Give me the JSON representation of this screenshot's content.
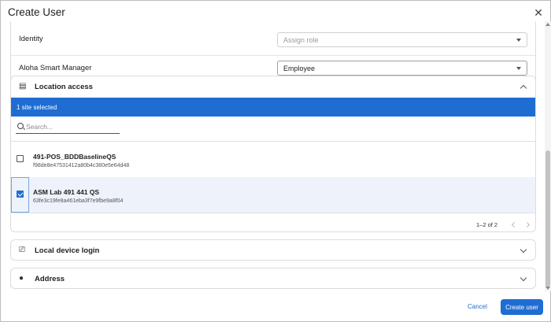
{
  "dialog": {
    "title": "Create User"
  },
  "roles": {
    "rows": [
      {
        "label": "Identity",
        "placeholder": "Assign role",
        "value": ""
      },
      {
        "label": "Aloha Smart Manager",
        "value": "Employee"
      }
    ]
  },
  "location_access": {
    "title": "Location access",
    "icon": "store-icon",
    "banner": "1 site selected",
    "search_placeholder": "Search...",
    "sites": [
      {
        "name": "491-POS_BDDBaselineQS",
        "id": "f98de8e47531412a80b4c380e5e64d48",
        "checked": false
      },
      {
        "name": "ASM Lab 491 441 QS",
        "id": "63fe3c19fe8a461eba3f7e9fbe9a8f04",
        "checked": true
      }
    ],
    "pagination": "1–2 of 2"
  },
  "local_device_login": {
    "title": "Local device login",
    "icon": "device-icon"
  },
  "address": {
    "title": "Address",
    "icon": "location-pin-icon"
  },
  "footer": {
    "cancel_label": "Cancel",
    "create_label": "Create user"
  },
  "colors": {
    "accent": "#1f6dd3",
    "selected_row": "#eef3fb"
  }
}
